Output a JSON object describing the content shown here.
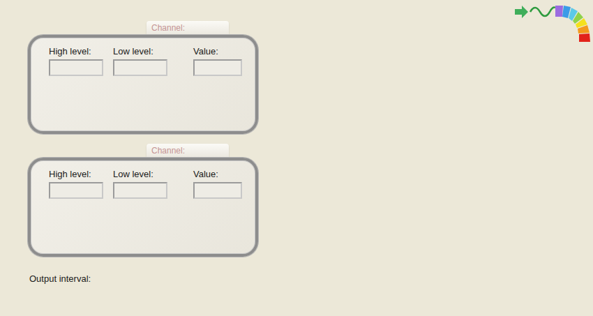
{
  "channels": [
    {
      "tab": "Channel:",
      "fields": [
        {
          "label": "High level:",
          "value": ""
        },
        {
          "label": "Low level:",
          "value": ""
        },
        {
          "label": "Value:",
          "value": ""
        }
      ]
    },
    {
      "tab": "Channel:",
      "fields": [
        {
          "label": "High level:",
          "value": ""
        },
        {
          "label": "Low level:",
          "value": ""
        },
        {
          "label": "Value:",
          "value": ""
        }
      ]
    }
  ],
  "output_interval": {
    "label": "Output interval:"
  }
}
